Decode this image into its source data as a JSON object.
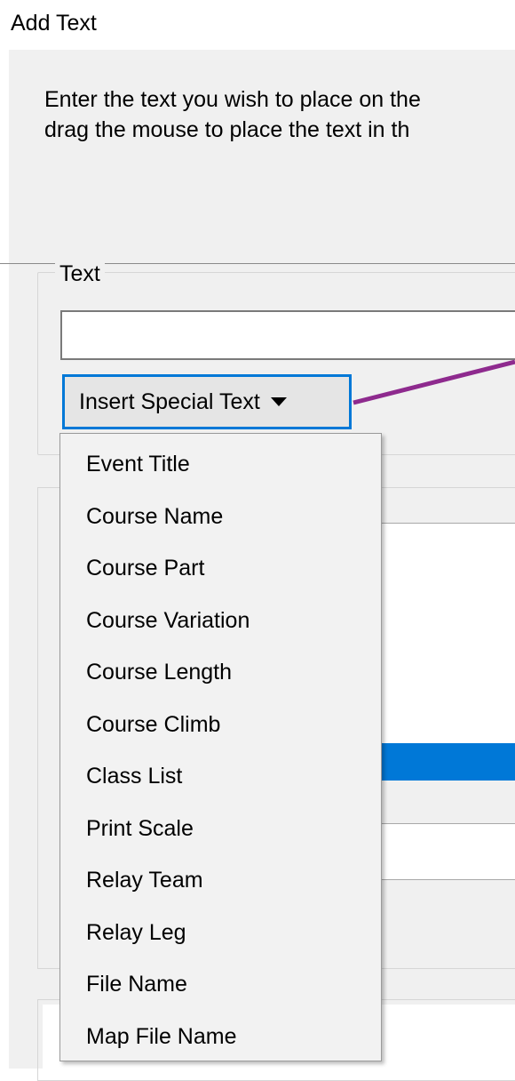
{
  "dialog": {
    "title": "Add Text",
    "instructions": [
      "Enter the text you wish to place on the",
      "drag the mouse to place the text in th"
    ]
  },
  "text_group": {
    "label": "Text",
    "input_value": "",
    "insert_button_label": "Insert Special Text"
  },
  "special_text_menu": {
    "items": [
      "Event Title",
      "Course Name",
      "Course Part",
      "Course Variation",
      "Course Length",
      "Course Climb",
      "Class List",
      "Print Scale",
      "Relay Team",
      "Relay Leg",
      "File Name",
      "Map File Name"
    ]
  },
  "colors": {
    "accent": "#0078d7",
    "annotation_line": "#8e2a8e",
    "dialog_background": "#f0f0f0"
  },
  "icons": {
    "dropdown": "chevron-down-icon"
  }
}
